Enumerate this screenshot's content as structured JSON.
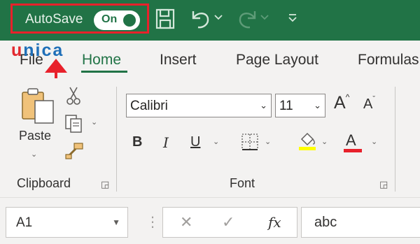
{
  "titlebar": {
    "autosave_label": "AutoSave",
    "toggle_state": "On",
    "accent_color": "#217346",
    "highlight_color": "#e8212b"
  },
  "logo": {
    "first": "u",
    "rest": "nica"
  },
  "tabs": [
    {
      "label": "File"
    },
    {
      "label": "Home",
      "active": true
    },
    {
      "label": "Insert"
    },
    {
      "label": "Page Layout"
    },
    {
      "label": "Formulas"
    }
  ],
  "clipboard": {
    "paste_label": "Paste",
    "group_label": "Clipboard"
  },
  "font": {
    "font_name": "Calibri",
    "font_size": "11",
    "bold": "B",
    "italic": "I",
    "underline": "U",
    "grow": "A",
    "shrink": "A",
    "font_color_glyph": "A",
    "highlight_yellow": "#ffff00",
    "font_red": "#e8212b",
    "group_label": "Font"
  },
  "formula_bar": {
    "name_box": "A1",
    "cancel_glyph": "✕",
    "enter_glyph": "✓",
    "fx_label": "fx",
    "content": "abc"
  }
}
